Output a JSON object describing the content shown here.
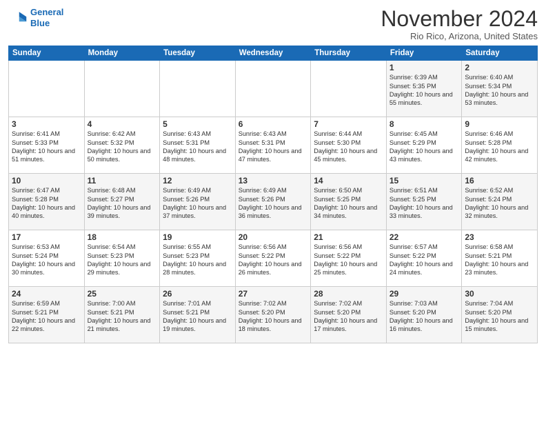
{
  "logo": {
    "line1": "General",
    "line2": "Blue"
  },
  "title": "November 2024",
  "location": "Rio Rico, Arizona, United States",
  "headers": [
    "Sunday",
    "Monday",
    "Tuesday",
    "Wednesday",
    "Thursday",
    "Friday",
    "Saturday"
  ],
  "weeks": [
    [
      {
        "day": "",
        "content": ""
      },
      {
        "day": "",
        "content": ""
      },
      {
        "day": "",
        "content": ""
      },
      {
        "day": "",
        "content": ""
      },
      {
        "day": "",
        "content": ""
      },
      {
        "day": "1",
        "content": "Sunrise: 6:39 AM\nSunset: 5:35 PM\nDaylight: 10 hours and 55 minutes."
      },
      {
        "day": "2",
        "content": "Sunrise: 6:40 AM\nSunset: 5:34 PM\nDaylight: 10 hours and 53 minutes."
      }
    ],
    [
      {
        "day": "3",
        "content": "Sunrise: 6:41 AM\nSunset: 5:33 PM\nDaylight: 10 hours and 51 minutes."
      },
      {
        "day": "4",
        "content": "Sunrise: 6:42 AM\nSunset: 5:32 PM\nDaylight: 10 hours and 50 minutes."
      },
      {
        "day": "5",
        "content": "Sunrise: 6:43 AM\nSunset: 5:31 PM\nDaylight: 10 hours and 48 minutes."
      },
      {
        "day": "6",
        "content": "Sunrise: 6:43 AM\nSunset: 5:31 PM\nDaylight: 10 hours and 47 minutes."
      },
      {
        "day": "7",
        "content": "Sunrise: 6:44 AM\nSunset: 5:30 PM\nDaylight: 10 hours and 45 minutes."
      },
      {
        "day": "8",
        "content": "Sunrise: 6:45 AM\nSunset: 5:29 PM\nDaylight: 10 hours and 43 minutes."
      },
      {
        "day": "9",
        "content": "Sunrise: 6:46 AM\nSunset: 5:28 PM\nDaylight: 10 hours and 42 minutes."
      }
    ],
    [
      {
        "day": "10",
        "content": "Sunrise: 6:47 AM\nSunset: 5:28 PM\nDaylight: 10 hours and 40 minutes."
      },
      {
        "day": "11",
        "content": "Sunrise: 6:48 AM\nSunset: 5:27 PM\nDaylight: 10 hours and 39 minutes."
      },
      {
        "day": "12",
        "content": "Sunrise: 6:49 AM\nSunset: 5:26 PM\nDaylight: 10 hours and 37 minutes."
      },
      {
        "day": "13",
        "content": "Sunrise: 6:49 AM\nSunset: 5:26 PM\nDaylight: 10 hours and 36 minutes."
      },
      {
        "day": "14",
        "content": "Sunrise: 6:50 AM\nSunset: 5:25 PM\nDaylight: 10 hours and 34 minutes."
      },
      {
        "day": "15",
        "content": "Sunrise: 6:51 AM\nSunset: 5:25 PM\nDaylight: 10 hours and 33 minutes."
      },
      {
        "day": "16",
        "content": "Sunrise: 6:52 AM\nSunset: 5:24 PM\nDaylight: 10 hours and 32 minutes."
      }
    ],
    [
      {
        "day": "17",
        "content": "Sunrise: 6:53 AM\nSunset: 5:24 PM\nDaylight: 10 hours and 30 minutes."
      },
      {
        "day": "18",
        "content": "Sunrise: 6:54 AM\nSunset: 5:23 PM\nDaylight: 10 hours and 29 minutes."
      },
      {
        "day": "19",
        "content": "Sunrise: 6:55 AM\nSunset: 5:23 PM\nDaylight: 10 hours and 28 minutes."
      },
      {
        "day": "20",
        "content": "Sunrise: 6:56 AM\nSunset: 5:22 PM\nDaylight: 10 hours and 26 minutes."
      },
      {
        "day": "21",
        "content": "Sunrise: 6:56 AM\nSunset: 5:22 PM\nDaylight: 10 hours and 25 minutes."
      },
      {
        "day": "22",
        "content": "Sunrise: 6:57 AM\nSunset: 5:22 PM\nDaylight: 10 hours and 24 minutes."
      },
      {
        "day": "23",
        "content": "Sunrise: 6:58 AM\nSunset: 5:21 PM\nDaylight: 10 hours and 23 minutes."
      }
    ],
    [
      {
        "day": "24",
        "content": "Sunrise: 6:59 AM\nSunset: 5:21 PM\nDaylight: 10 hours and 22 minutes."
      },
      {
        "day": "25",
        "content": "Sunrise: 7:00 AM\nSunset: 5:21 PM\nDaylight: 10 hours and 21 minutes."
      },
      {
        "day": "26",
        "content": "Sunrise: 7:01 AM\nSunset: 5:21 PM\nDaylight: 10 hours and 19 minutes."
      },
      {
        "day": "27",
        "content": "Sunrise: 7:02 AM\nSunset: 5:20 PM\nDaylight: 10 hours and 18 minutes."
      },
      {
        "day": "28",
        "content": "Sunrise: 7:02 AM\nSunset: 5:20 PM\nDaylight: 10 hours and 17 minutes."
      },
      {
        "day": "29",
        "content": "Sunrise: 7:03 AM\nSunset: 5:20 PM\nDaylight: 10 hours and 16 minutes."
      },
      {
        "day": "30",
        "content": "Sunrise: 7:04 AM\nSunset: 5:20 PM\nDaylight: 10 hours and 15 minutes."
      }
    ]
  ]
}
